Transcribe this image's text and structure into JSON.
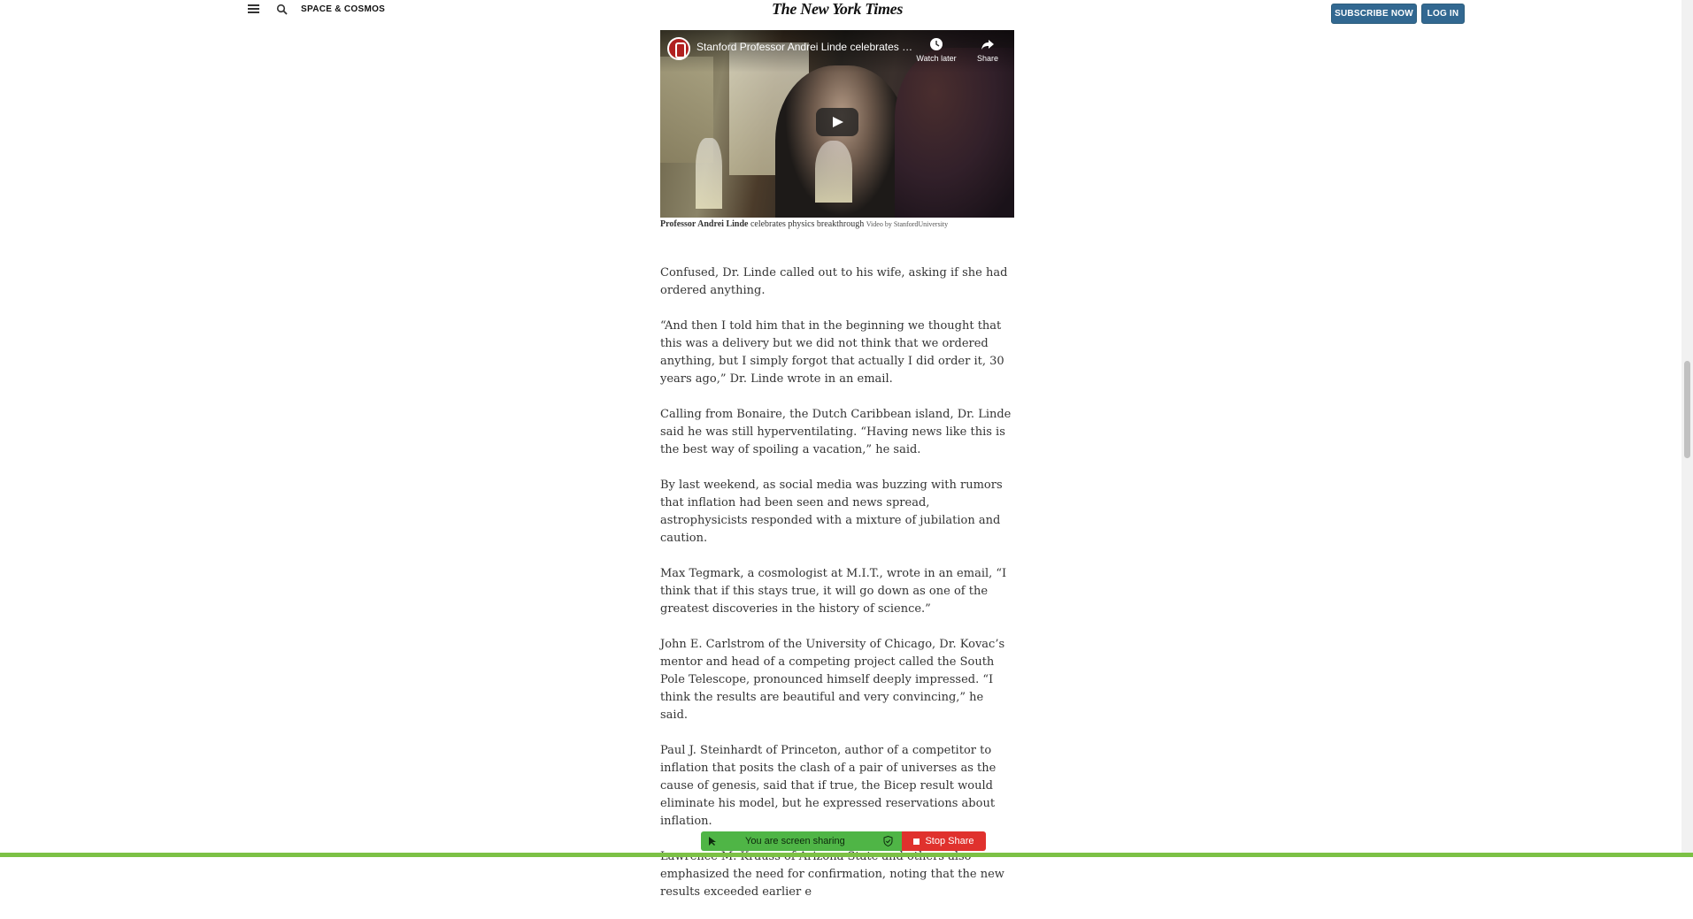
{
  "header": {
    "section_label": "SPACE & COSMOS",
    "masthead": "The New York Times",
    "subscribe_label": "SUBSCRIBE NOW",
    "login_label": "LOG IN"
  },
  "video": {
    "title": "Stanford Professor Andrei Linde celebrates …",
    "watch_later_label": "Watch later",
    "share_label": "Share"
  },
  "caption": {
    "name": "Professor Andrei Linde",
    "text": " celebrates physics breakthrough ",
    "credit": "Video by StanfordUniversity"
  },
  "article": {
    "paragraphs": [
      "Confused, Dr. Linde called out to his wife, asking if she had ordered anything.",
      "“And then I told him that in the beginning we thought that this was a delivery but we did not think that we ordered anything, but I simply forgot that actually I did order it, 30 years ago,” Dr. Linde wrote in an email.",
      "Calling from Bonaire, the Dutch Caribbean island, Dr. Linde said he was still hyperventilating. “Having news like this is the best way of spoiling a vacation,” he said.",
      "By last weekend, as social media was buzzing with rumors that inflation had been seen and news spread, astrophysicists responded with a mixture of jubilation and caution.",
      "Max Tegmark, a cosmologist at M.I.T., wrote in an email, “I think that if this stays true, it will go down as one of the greatest discoveries in the history of science.”",
      "John E. Carlstrom of the University of Chicago, Dr. Kovac’s mentor and head of a competing project called the South Pole Telescope, pronounced himself deeply impressed. “I think the results are beautiful and very convincing,” he said.",
      "Paul J. Steinhardt of Princeton, author of a competitor to inflation that posits the clash of a pair of universes as the cause of genesis, said that if true, the Bicep result would eliminate his model, but he expressed reservations about inflation.",
      "Lawrence M. Krauss of Arizona State and others also emphasized the need for confirmation, noting that the new results exceeded earlier e"
    ]
  },
  "screen_share": {
    "status": "You are screen sharing",
    "stop_label": "Stop Share"
  },
  "colors": {
    "button_blue": "#326891",
    "share_green": "#4fb546",
    "stop_red": "#e0312d",
    "frame_green": "#7cc145"
  }
}
